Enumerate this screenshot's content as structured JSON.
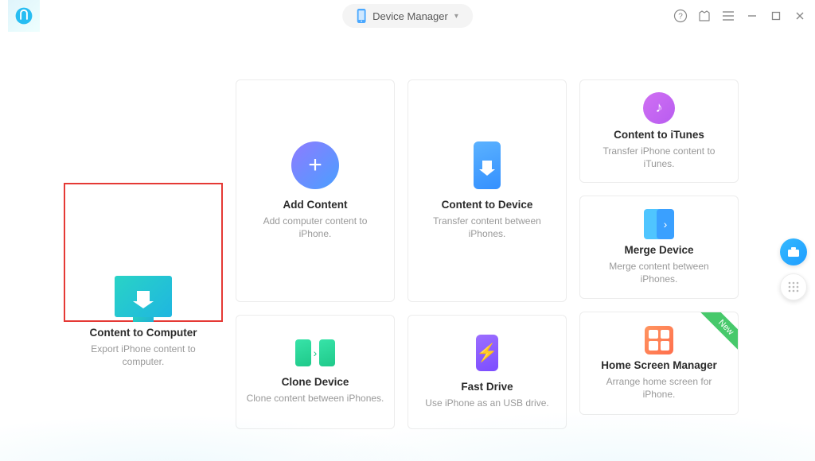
{
  "header": {
    "mode_label": "Device Manager"
  },
  "cards": {
    "content_to_computer": {
      "title": "Content to Computer",
      "desc": "Export iPhone content to computer."
    },
    "add_content": {
      "title": "Add Content",
      "desc": "Add computer content to iPhone."
    },
    "clone_device": {
      "title": "Clone Device",
      "desc": "Clone content between iPhones."
    },
    "content_to_device": {
      "title": "Content to Device",
      "desc": "Transfer content between iPhones."
    },
    "fast_drive": {
      "title": "Fast Drive",
      "desc": "Use iPhone as an USB drive."
    },
    "content_to_itunes": {
      "title": "Content to iTunes",
      "desc": "Transfer iPhone content to iTunes."
    },
    "merge_device": {
      "title": "Merge Device",
      "desc": "Merge content between iPhones."
    },
    "home_screen_manager": {
      "title": "Home Screen Manager",
      "desc": "Arrange home screen for iPhone.",
      "badge": "New"
    }
  }
}
